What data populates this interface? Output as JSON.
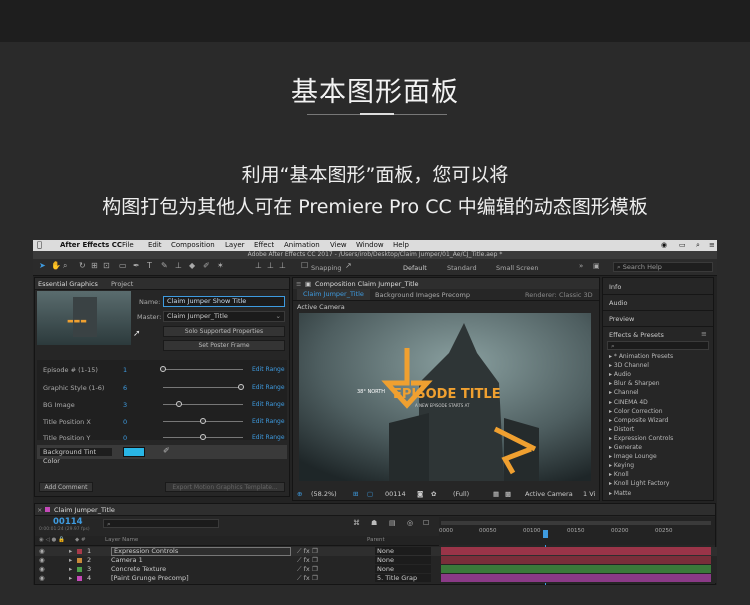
{
  "heading": {
    "title": "基本图形面板",
    "line1": "利用“基本图形”面板，您可以将",
    "line2": "构图打包为其他人可在 Premiere Pro CC 中编辑的动态图形模板"
  },
  "app": {
    "menus": [
      "After Effects CC",
      "File",
      "Edit",
      "Composition",
      "Layer",
      "Effect",
      "Animation",
      "View",
      "Window",
      "Help"
    ],
    "window_title": "Adobe After Effects CC 2017 - /Users/irob/Desktop/Claim Jumper/01_Ae/CJ_Title.aep *",
    "toolbar": {
      "snapping": "Snapping",
      "workspaces": [
        "Default",
        "Standard",
        "Small Screen"
      ],
      "search_placeholder": "Search Help"
    },
    "essential_graphics": {
      "tabs": [
        "Essential Graphics",
        "Project"
      ],
      "name_label": "Name:",
      "name_value": "Claim Jumper Show Title",
      "master_label": "Master:",
      "master_value": "Claim Jumper_Title",
      "solo_button": "Solo Supported Properties",
      "poster_button": "Set Poster Frame",
      "properties": [
        {
          "label": "Episode # (1-15)",
          "value": "1",
          "edit": "Edit Range",
          "knob": 0.0
        },
        {
          "label": "Graphic Style (1-6)",
          "value": "6",
          "edit": "Edit Range",
          "knob": 1.0
        },
        {
          "label": "BG Image",
          "value": "3",
          "edit": "Edit Range",
          "knob": 0.2
        },
        {
          "label": "Title Position X",
          "value": "0",
          "edit": "Edit Range",
          "knob": 0.5
        },
        {
          "label": "Title Position Y",
          "value": "0",
          "edit": "Edit Range",
          "knob": 0.5
        }
      ],
      "tint_label": "Background Tint Color",
      "tint_color": "#29b6e6",
      "add_comment": "Add Comment",
      "export_button": "Export Motion Graphics Template..."
    },
    "composition": {
      "panel_tab": "Composition Claim Jumper_Title",
      "breadcrumbs": [
        "Claim Jumper_Title",
        "Background Images Precomp"
      ],
      "renderer_label": "Renderer:",
      "renderer_value": "Classic 3D",
      "camera_label": "Active Camera",
      "preview_north": "38° NORTH",
      "preview_title": "EPISODE TITLE",
      "preview_subtitle": "A NEW EPISODE STARTS AT",
      "zoom": "(58.2%)",
      "timecode": "00114",
      "resolution": "(Full)",
      "camera_dropdown": "Active Camera",
      "views": "1 Vi"
    },
    "right_panels": {
      "info": "Info",
      "audio": "Audio",
      "preview": "Preview",
      "effects_title": "Effects & Presets",
      "effects": [
        "* Animation Presets",
        "3D Channel",
        "Audio",
        "Blur & Sharpen",
        "Channel",
        "CINEMA 4D",
        "Color Correction",
        "Composite Wizard",
        "Distort",
        "Expression Controls",
        "Generate",
        "Image Lounge",
        "Keying",
        "Knoll",
        "Knoll Light Factory",
        "Matte"
      ]
    },
    "timeline": {
      "tab": "Claim Jumper_Title",
      "timecode": "00114",
      "timecode_sub": "0:00:01:24 (29.97 fps)",
      "column_layer_name": "Layer Name",
      "column_parent": "Parent",
      "ruler": [
        "0000",
        "00050",
        "00100",
        "00150",
        "00200",
        "00250"
      ],
      "layers": [
        {
          "num": "1",
          "name": "Expression Controls",
          "parent": "None",
          "color": "#a83a4a",
          "bar": "#9a3448"
        },
        {
          "num": "2",
          "name": "Camera 1",
          "parent": "None",
          "color": "#c98a3a",
          "bar": "#7a2e3a"
        },
        {
          "num": "3",
          "name": "Concrete Texture",
          "parent": "None",
          "color": "#4da04a",
          "bar": "#3a7a3a"
        },
        {
          "num": "4",
          "name": "[Paint Grunge Precomp]",
          "parent": "5. Title Grap",
          "color": "#c44ab8",
          "bar": "#8a3a86"
        }
      ]
    }
  }
}
